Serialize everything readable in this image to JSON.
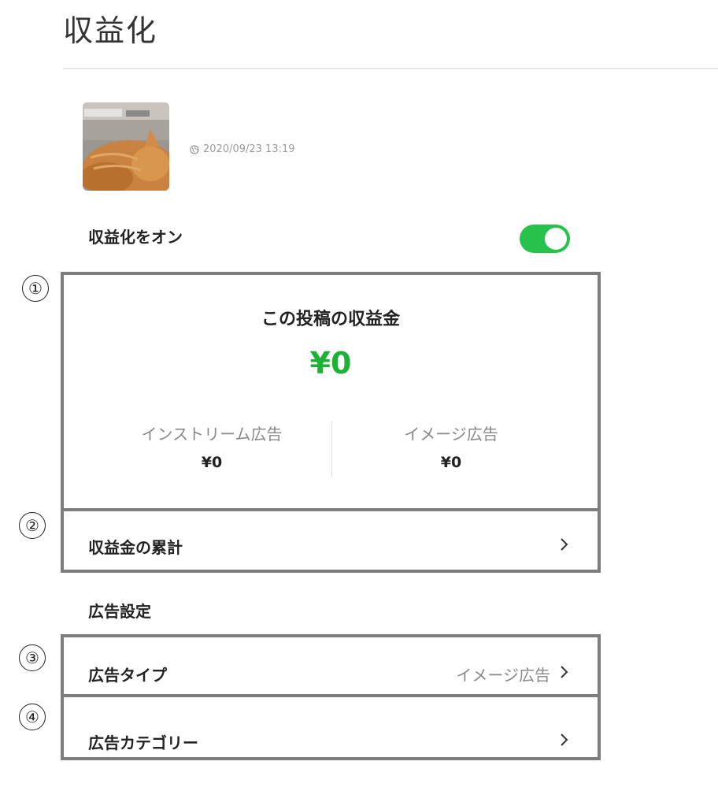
{
  "page": {
    "title": "収益化"
  },
  "post": {
    "thumbnail_icon": "cat-photo-thumbnail",
    "globe_icon": "globe-icon",
    "timestamp": "2020/09/23 13:19"
  },
  "monetization": {
    "label": "収益化をオン",
    "enabled": true,
    "toggle_color": "#27c24c"
  },
  "revenue": {
    "title": "この投稿の収益金",
    "total": "¥0",
    "total_color": "#1db235",
    "instream": {
      "label": "インストリーム広告",
      "value": "¥0"
    },
    "image": {
      "label": "イメージ広告",
      "value": "¥0"
    }
  },
  "cumulative": {
    "label": "収益金の累計",
    "chevron_icon": "chevron-right-icon"
  },
  "ad_settings": {
    "heading": "広告設定",
    "ad_type": {
      "label": "広告タイプ",
      "value": "イメージ広告"
    },
    "ad_category": {
      "label": "広告カテゴリー"
    }
  },
  "callouts": [
    "①",
    "②",
    "③",
    "④"
  ],
  "frame_color": "#7d7d7d"
}
